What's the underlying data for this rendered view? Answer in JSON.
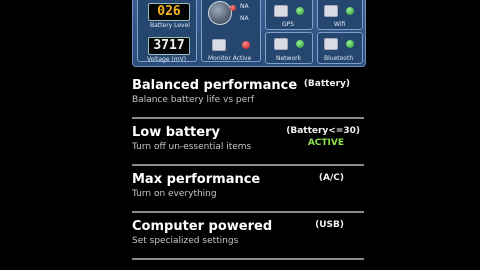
{
  "monitor": {
    "battery_level": "026",
    "battery_level_label": "Battery Level",
    "voltage": "3717",
    "voltage_label": "Voltage (mV)",
    "dial_top": "NA",
    "dial_bottom": "NA",
    "monitor_active_label": "Monitor Active",
    "toggles": [
      {
        "label": "GPS"
      },
      {
        "label": "Wifi"
      },
      {
        "label": "Network"
      },
      {
        "label": "Bluetooth"
      }
    ]
  },
  "profiles": [
    {
      "title": "Balanced performance",
      "subtitle": "Balance battery life vs perf",
      "tag": "(Battery)",
      "status": ""
    },
    {
      "title": "Low battery",
      "subtitle": "Turn off un-essential items",
      "tag": "(Battery<=30)",
      "status": "ACTIVE"
    },
    {
      "title": "Max performance",
      "subtitle": "Turn on everything",
      "tag": "(A/C)",
      "status": ""
    },
    {
      "title": "Computer powered",
      "subtitle": "Set specialized settings",
      "tag": "(USB)",
      "status": ""
    }
  ],
  "colors": {
    "active": "#8ee04a",
    "lcd_amber": "#f6b21a",
    "panel": "#2a4d7a"
  }
}
